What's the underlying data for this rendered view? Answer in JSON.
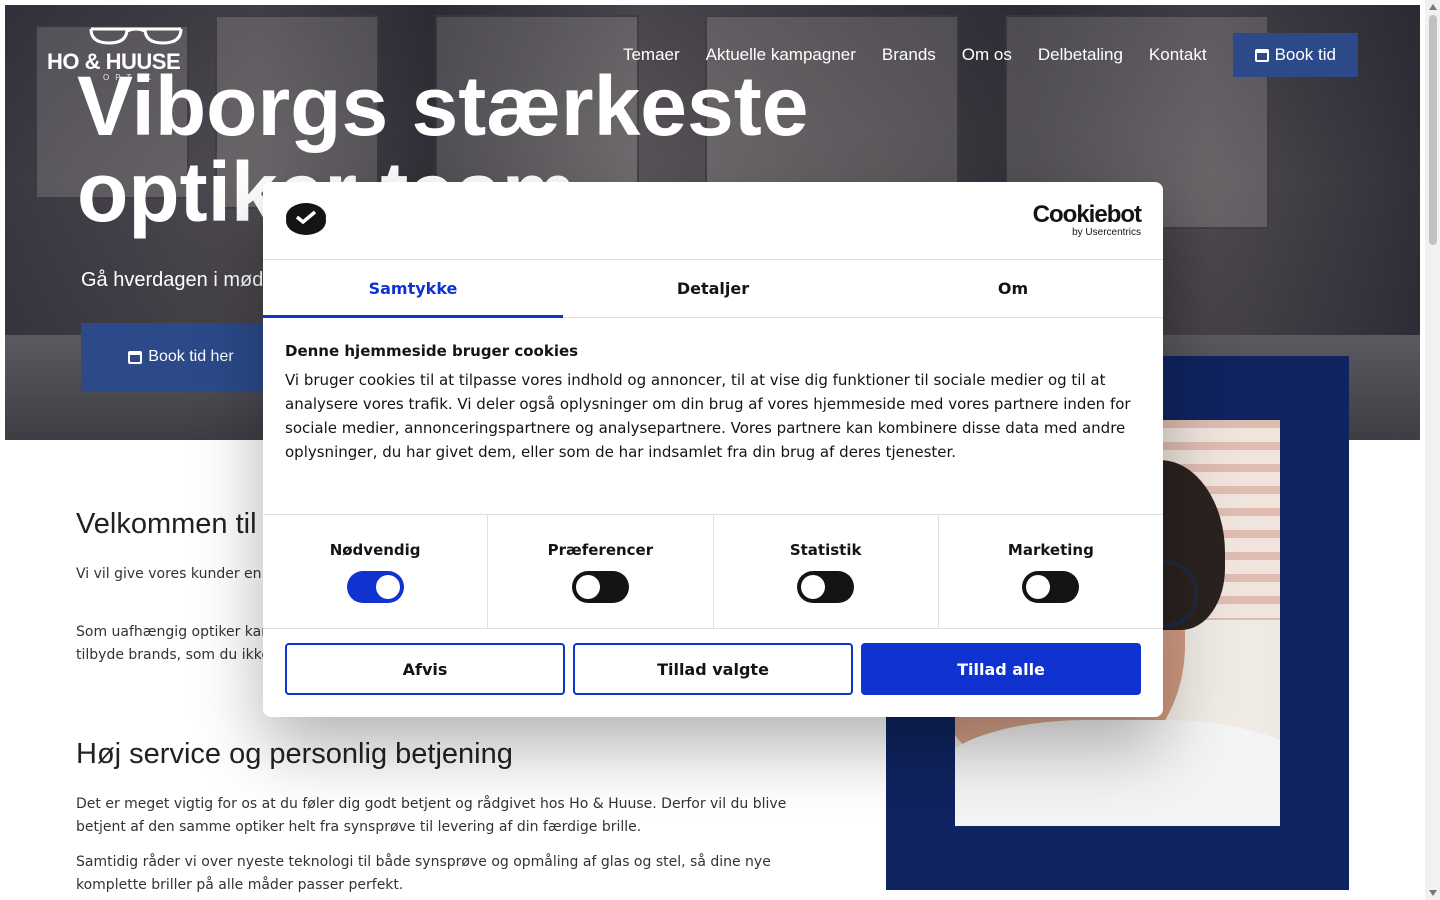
{
  "header": {
    "logo_text": "HO & HUUSE",
    "logo_sub": "OPTIK",
    "nav": [
      "Temaer",
      "Aktuelle kampagner",
      "Brands",
      "Om os",
      "Delbetaling",
      "Kontakt"
    ],
    "book_label": "Book tid"
  },
  "hero": {
    "title": "Viborgs stærkeste optiker team",
    "subtitle": "Gå hverdagen i møde",
    "button_label": "Book tid her"
  },
  "content": {
    "welcome_heading": "Velkommen til Ho & Huuse",
    "p1": "Vi vil give vores kunder en unik oplevelse med brillestel fra de dygtigste brilledesignere i verden.",
    "p2": "Som uafhængig optiker kan vi finde de helt rigtige briller til din personlighed og ønsker. Så kan vi tilbyde brands, som du ikke finder andre steder i landet.",
    "service_heading": "Høj service og personlig betjening",
    "p3": "Det er meget vigtig for os at du føler dig godt betjent og rådgivet hos Ho & Huuse. Derfor vil du blive betjent af den samme optiker helt fra synsprøve til levering af din færdige brille.",
    "p4": "Samtidig råder vi over nyeste teknologi til både synsprøve og opmåling af glas og stel, så dine nye komplette briller på alle måder passer perfekt."
  },
  "cookie": {
    "brand": "Cookiebot",
    "brand_sub": "by Usercentrics",
    "tabs": [
      "Samtykke",
      "Detaljer",
      "Om"
    ],
    "active_tab": "Samtykke",
    "heading": "Denne hjemmeside bruger cookies",
    "body": "Vi bruger cookies til at tilpasse vores indhold og annoncer, til at vise dig funktioner til sociale medier og til at analysere vores trafik. Vi deler også oplysninger om din brug af vores hjemmeside med vores partnere inden for sociale medier, annonceringspartnere og analysepartnere. Vores partnere kan kombinere disse data med andre oplysninger, du har givet dem, eller som de har indsamlet fra din brug af deres tjenester.",
    "toggles": [
      {
        "label": "Nødvendig",
        "on": true
      },
      {
        "label": "Præferencer",
        "on": false
      },
      {
        "label": "Statistik",
        "on": false
      },
      {
        "label": "Marketing",
        "on": false
      }
    ],
    "buttons": {
      "deny": "Afvis",
      "allow_selected": "Tillad valgte",
      "allow_all": "Tillad alle"
    },
    "accent_color": "#1032cf"
  }
}
